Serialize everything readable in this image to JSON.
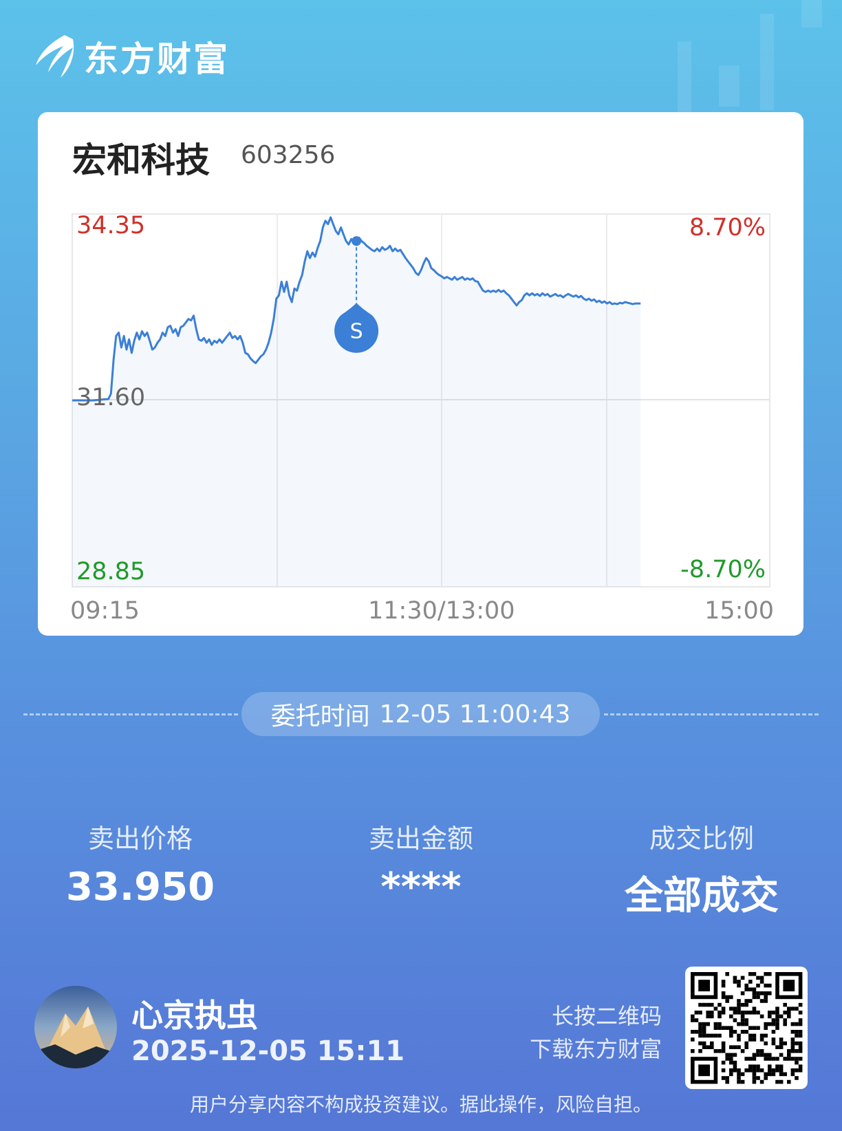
{
  "brand": {
    "name": "东方财富"
  },
  "stock": {
    "name": "宏和科技",
    "code": "603256"
  },
  "chart_data": {
    "type": "line",
    "price_high_label": "34.35",
    "price_mid_label": "31.60",
    "price_low_label": "28.85",
    "pct_high_label": "8.70%",
    "pct_low_label": "-8.70%",
    "time_labels": [
      "09:15",
      "11:30/13:00",
      "15:00"
    ],
    "ylim": [
      28.85,
      34.35
    ],
    "prev_close": 31.6,
    "x_session_minutes": [
      0,
      270
    ],
    "series": [
      {
        "points": [
          [
            0,
            31.6
          ],
          [
            8,
            31.6
          ],
          [
            14,
            31.62
          ],
          [
            15,
            31.7
          ],
          [
            16,
            32.2
          ],
          [
            17,
            32.55
          ],
          [
            18,
            32.6
          ],
          [
            19,
            32.38
          ],
          [
            20,
            32.55
          ],
          [
            21,
            32.35
          ],
          [
            22,
            32.5
          ],
          [
            23,
            32.3
          ],
          [
            24,
            32.48
          ],
          [
            25,
            32.6
          ],
          [
            26,
            32.5
          ],
          [
            27,
            32.62
          ],
          [
            28,
            32.55
          ],
          [
            29,
            32.6
          ],
          [
            30,
            32.48
          ],
          [
            31,
            32.35
          ],
          [
            32,
            32.38
          ],
          [
            33,
            32.45
          ],
          [
            34,
            32.5
          ],
          [
            35,
            32.6
          ],
          [
            36,
            32.55
          ],
          [
            37,
            32.68
          ],
          [
            38,
            32.7
          ],
          [
            39,
            32.6
          ],
          [
            40,
            32.65
          ],
          [
            41,
            32.55
          ],
          [
            42,
            32.68
          ],
          [
            43,
            32.7
          ],
          [
            44,
            32.75
          ],
          [
            45,
            32.8
          ],
          [
            46,
            32.78
          ],
          [
            47,
            32.85
          ],
          [
            48,
            32.65
          ],
          [
            49,
            32.5
          ],
          [
            50,
            32.48
          ],
          [
            51,
            32.52
          ],
          [
            52,
            32.45
          ],
          [
            53,
            32.5
          ],
          [
            54,
            32.42
          ],
          [
            55,
            32.48
          ],
          [
            56,
            32.45
          ],
          [
            57,
            32.5
          ],
          [
            58,
            32.45
          ],
          [
            59,
            32.5
          ],
          [
            60,
            32.55
          ],
          [
            61,
            32.6
          ],
          [
            62,
            32.52
          ],
          [
            63,
            32.55
          ],
          [
            64,
            32.5
          ],
          [
            65,
            32.55
          ],
          [
            66,
            32.45
          ],
          [
            67,
            32.3
          ],
          [
            68,
            32.28
          ],
          [
            69,
            32.22
          ],
          [
            70,
            32.18
          ],
          [
            71,
            32.15
          ],
          [
            72,
            32.2
          ],
          [
            73,
            32.25
          ],
          [
            74,
            32.28
          ],
          [
            75,
            32.35
          ],
          [
            76,
            32.45
          ],
          [
            77,
            32.6
          ],
          [
            78,
            32.8
          ],
          [
            79,
            33.1
          ],
          [
            80,
            33.15
          ],
          [
            81,
            33.35
          ],
          [
            82,
            33.2
          ],
          [
            83,
            33.35
          ],
          [
            84,
            33.15
          ],
          [
            85,
            33.05
          ],
          [
            86,
            33.25
          ],
          [
            87,
            33.22
          ],
          [
            88,
            33.35
          ],
          [
            89,
            33.45
          ],
          [
            90,
            33.65
          ],
          [
            91,
            33.8
          ],
          [
            92,
            33.7
          ],
          [
            93,
            33.78
          ],
          [
            94,
            33.72
          ],
          [
            95,
            33.85
          ],
          [
            96,
            33.95
          ],
          [
            97,
            34.15
          ],
          [
            98,
            34.25
          ],
          [
            99,
            34.2
          ],
          [
            100,
            34.3
          ],
          [
            101,
            34.2
          ],
          [
            102,
            34.1
          ],
          [
            103,
            34.05
          ],
          [
            104,
            34.15
          ],
          [
            105,
            34.05
          ],
          [
            106,
            33.95
          ],
          [
            107,
            33.9
          ],
          [
            108,
            33.98
          ],
          [
            109,
            33.92
          ],
          [
            110,
            33.98
          ],
          [
            111,
            34.0
          ],
          [
            112,
            33.95
          ],
          [
            113,
            33.92
          ],
          [
            114,
            33.88
          ],
          [
            115,
            33.85
          ],
          [
            116,
            33.82
          ],
          [
            117,
            33.8
          ],
          [
            118,
            33.84
          ],
          [
            119,
            33.8
          ],
          [
            120,
            33.86
          ],
          [
            121,
            33.82
          ],
          [
            122,
            33.84
          ],
          [
            123,
            33.88
          ],
          [
            124,
            33.8
          ],
          [
            125,
            33.84
          ],
          [
            126,
            33.8
          ],
          [
            127,
            33.82
          ],
          [
            128,
            33.76
          ],
          [
            129,
            33.7
          ],
          [
            130,
            33.65
          ],
          [
            131,
            33.6
          ],
          [
            132,
            33.55
          ],
          [
            133,
            33.48
          ],
          [
            134,
            33.45
          ],
          [
            135,
            33.52
          ],
          [
            136,
            33.62
          ],
          [
            137,
            33.7
          ],
          [
            138,
            33.65
          ],
          [
            139,
            33.55
          ],
          [
            140,
            33.52
          ],
          [
            141,
            33.48
          ],
          [
            142,
            33.45
          ],
          [
            143,
            33.43
          ],
          [
            144,
            33.4
          ],
          [
            145,
            33.42
          ],
          [
            146,
            33.4
          ],
          [
            147,
            33.38
          ],
          [
            148,
            33.42
          ],
          [
            149,
            33.38
          ],
          [
            150,
            33.4
          ],
          [
            151,
            33.42
          ],
          [
            152,
            33.38
          ],
          [
            153,
            33.4
          ],
          [
            154,
            33.38
          ],
          [
            155,
            33.4
          ],
          [
            156,
            33.36
          ],
          [
            157,
            33.35
          ],
          [
            158,
            33.28
          ],
          [
            159,
            33.22
          ],
          [
            160,
            33.2
          ],
          [
            161,
            33.22
          ],
          [
            162,
            33.2
          ],
          [
            163,
            33.22
          ],
          [
            164,
            33.2
          ],
          [
            165,
            33.23
          ],
          [
            166,
            33.2
          ],
          [
            167,
            33.22
          ],
          [
            168,
            33.18
          ],
          [
            169,
            33.15
          ],
          [
            170,
            33.1
          ],
          [
            171,
            33.05
          ],
          [
            172,
            33.0
          ],
          [
            173,
            33.05
          ],
          [
            174,
            33.08
          ],
          [
            175,
            33.15
          ],
          [
            176,
            33.18
          ],
          [
            177,
            33.15
          ],
          [
            178,
            33.18
          ],
          [
            179,
            33.15
          ],
          [
            180,
            33.17
          ],
          [
            181,
            33.14
          ],
          [
            182,
            33.18
          ],
          [
            183,
            33.15
          ],
          [
            184,
            33.17
          ],
          [
            185,
            33.13
          ],
          [
            186,
            33.15
          ],
          [
            187,
            33.17
          ],
          [
            188,
            33.14
          ],
          [
            189,
            33.15
          ],
          [
            190,
            33.12
          ],
          [
            191,
            33.15
          ],
          [
            192,
            33.17
          ],
          [
            193,
            33.15
          ],
          [
            194,
            33.13
          ],
          [
            195,
            33.15
          ],
          [
            196,
            33.12
          ],
          [
            197,
            33.14
          ],
          [
            198,
            33.1
          ],
          [
            199,
            33.08
          ],
          [
            200,
            33.1
          ],
          [
            201,
            33.07
          ],
          [
            202,
            33.09
          ],
          [
            203,
            33.05
          ],
          [
            204,
            33.07
          ],
          [
            205,
            33.04
          ],
          [
            206,
            33.06
          ],
          [
            207,
            33.03
          ],
          [
            208,
            33.05
          ],
          [
            209,
            33.02
          ],
          [
            210,
            33.03
          ],
          [
            211,
            33.02
          ],
          [
            212,
            33.04
          ],
          [
            213,
            33.03
          ],
          [
            214,
            33.05
          ],
          [
            215,
            33.04
          ],
          [
            216,
            33.03
          ],
          [
            217,
            33.02
          ],
          [
            218,
            33.03
          ],
          [
            220,
            33.03
          ]
        ]
      }
    ],
    "marker": {
      "label": "S",
      "time_min": 110,
      "price": 33.95
    }
  },
  "order": {
    "label": "委托时间",
    "time": "12-05 11:00:43"
  },
  "stats": [
    {
      "label": "卖出价格",
      "value": "33.950"
    },
    {
      "label": "卖出金额",
      "value": "****"
    },
    {
      "label": "成交比例",
      "value": "全部成交"
    }
  ],
  "user": {
    "name": "心京执虫",
    "datetime": "2025-12-05 15:11"
  },
  "qr": {
    "hint_line1": "长按二维码",
    "hint_line2": "下载东方财富"
  },
  "disclaimer": "用户分享内容不构成投资建议。据此操作，风险自担。"
}
